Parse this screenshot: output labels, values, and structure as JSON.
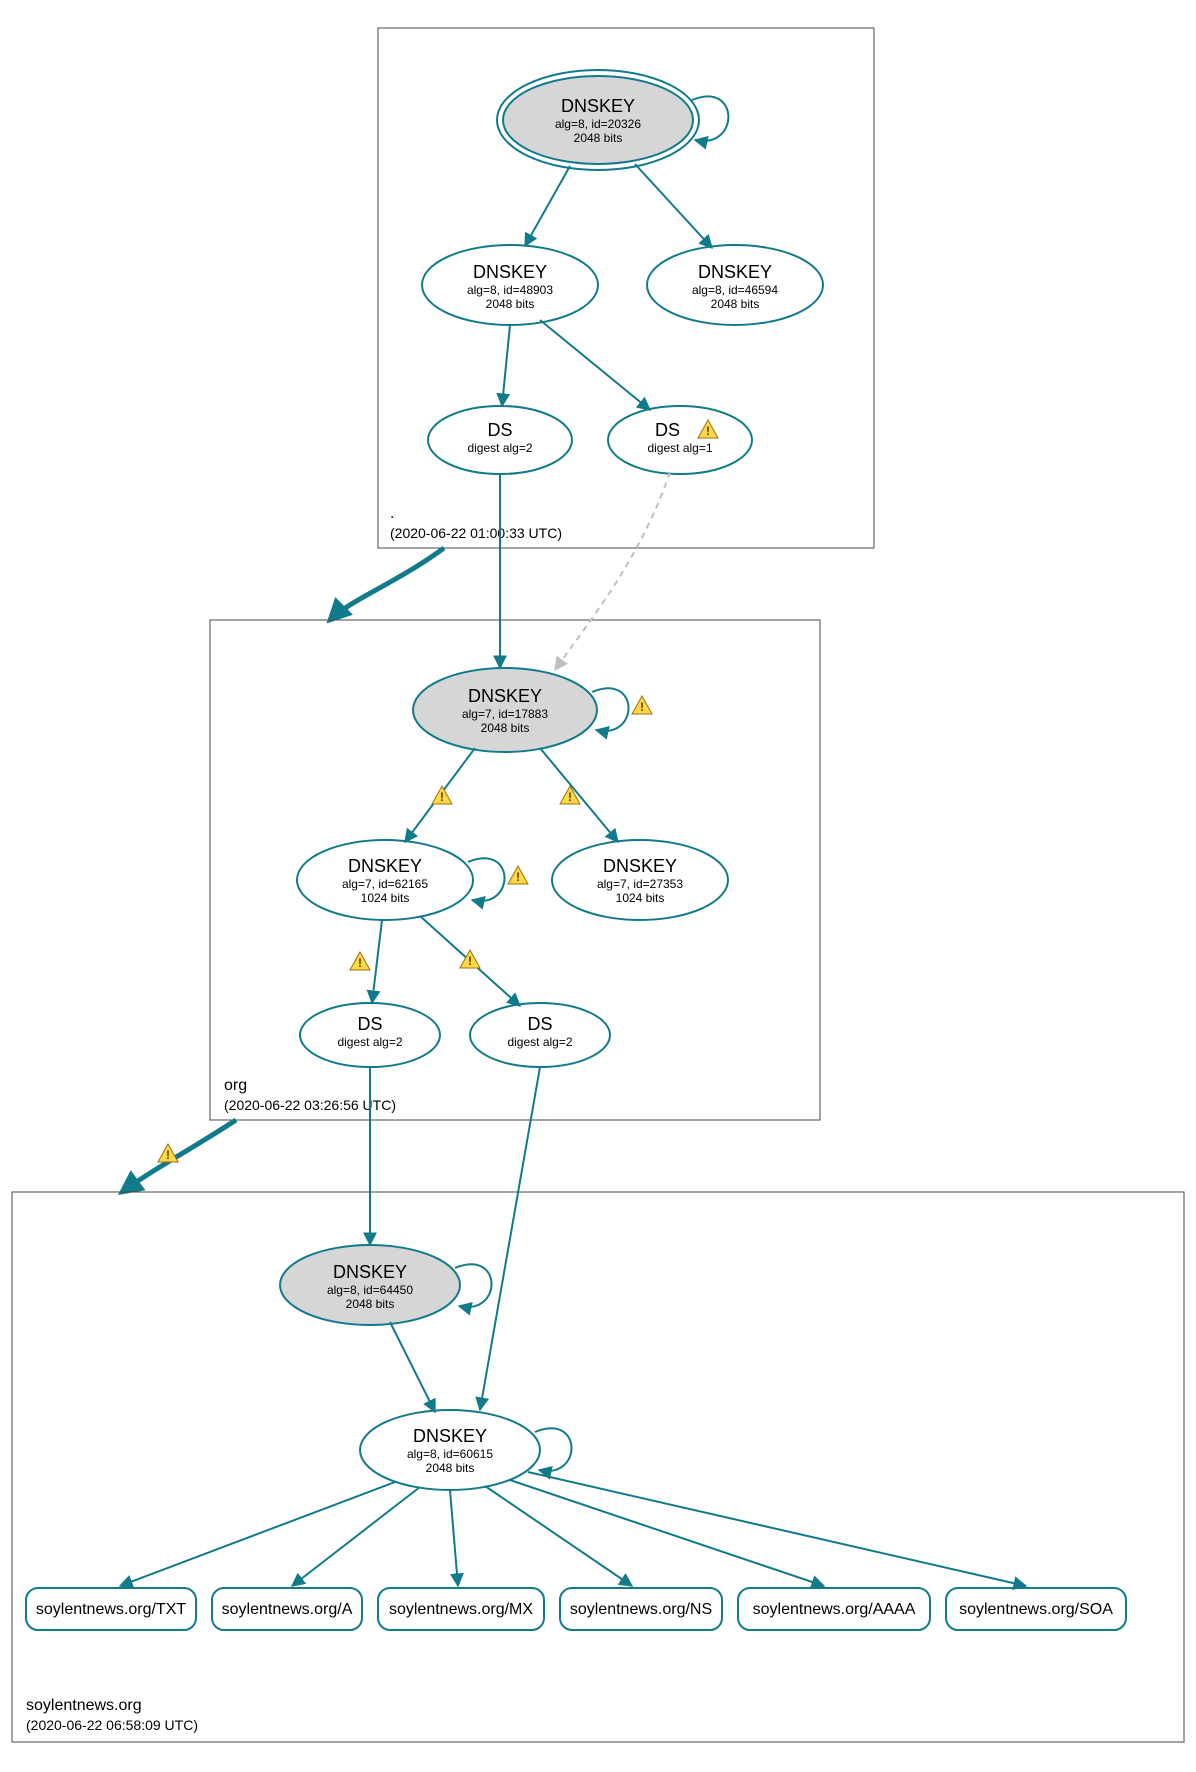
{
  "colors": {
    "teal": "#117a8b",
    "gray_fill": "#d6d6d6",
    "light_edge": "#bfbfbf",
    "text": "#000000",
    "box_stroke": "#4a4a4a"
  },
  "zones": {
    "root": {
      "label": ".",
      "timestamp": "(2020-06-22 01:00:33 UTC)"
    },
    "org": {
      "label": "org",
      "timestamp": "(2020-06-22 03:26:56 UTC)"
    },
    "domain": {
      "label": "soylentnews.org",
      "timestamp": "(2020-06-22 06:58:09 UTC)"
    }
  },
  "nodes": {
    "root_ksk": {
      "title": "DNSKEY",
      "line1": "alg=8, id=20326",
      "line2": "2048 bits"
    },
    "root_zsk1": {
      "title": "DNSKEY",
      "line1": "alg=8, id=48903",
      "line2": "2048 bits"
    },
    "root_zsk2": {
      "title": "DNSKEY",
      "line1": "alg=8, id=46594",
      "line2": "2048 bits"
    },
    "root_ds1": {
      "title": "DS",
      "line1": "digest alg=2",
      "line2": ""
    },
    "root_ds2": {
      "title": "DS",
      "line1": "digest alg=1",
      "line2": ""
    },
    "org_ksk": {
      "title": "DNSKEY",
      "line1": "alg=7, id=17883",
      "line2": "2048 bits"
    },
    "org_zsk1": {
      "title": "DNSKEY",
      "line1": "alg=7, id=62165",
      "line2": "1024 bits"
    },
    "org_zsk2": {
      "title": "DNSKEY",
      "line1": "alg=7, id=27353",
      "line2": "1024 bits"
    },
    "org_ds1": {
      "title": "DS",
      "line1": "digest alg=2",
      "line2": ""
    },
    "org_ds2": {
      "title": "DS",
      "line1": "digest alg=2",
      "line2": ""
    },
    "dom_ksk": {
      "title": "DNSKEY",
      "line1": "alg=8, id=64450",
      "line2": "2048 bits"
    },
    "dom_zsk": {
      "title": "DNSKEY",
      "line1": "alg=8, id=60615",
      "line2": "2048 bits"
    }
  },
  "rrsets": {
    "txt": "soylentnews.org/TXT",
    "a": "soylentnews.org/A",
    "mx": "soylentnews.org/MX",
    "ns": "soylentnews.org/NS",
    "aaaa": "soylentnews.org/AAAA",
    "soa": "soylentnews.org/SOA"
  }
}
